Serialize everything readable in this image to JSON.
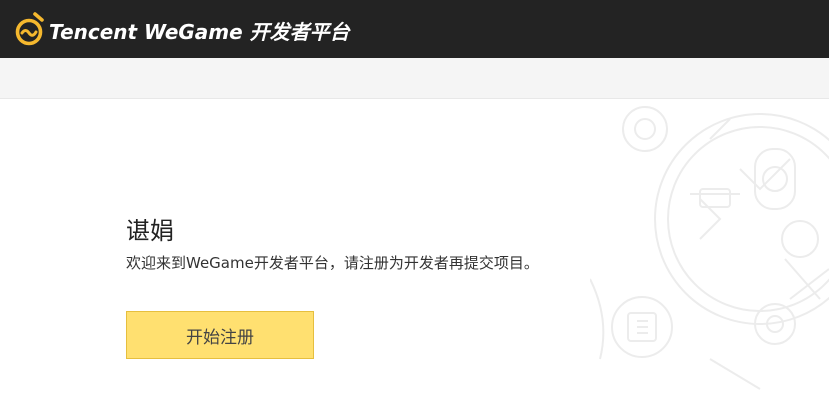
{
  "header": {
    "brand_text": "Tencent WeGame 开发者平台",
    "logo_icon": "wegame-logo-icon",
    "background_color": "#232323",
    "accent_color": "#f5b82e"
  },
  "main": {
    "username": "谌娟",
    "welcome_text": "欢迎来到WeGame开发者平台，请注册为开发者再提交项目。",
    "register_button_label": "开始注册",
    "button_color": "#ffe070"
  }
}
